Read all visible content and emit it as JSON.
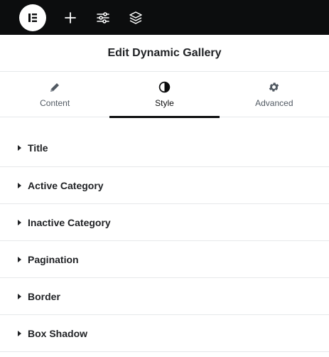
{
  "topbar": {
    "logo_icon": "elementor-logo-icon",
    "buttons": [
      {
        "name": "add-icon"
      },
      {
        "name": "settings-sliders-icon"
      },
      {
        "name": "layers-icon"
      }
    ]
  },
  "header": {
    "title": "Edit Dynamic Gallery"
  },
  "tabs": [
    {
      "label": "Content",
      "icon": "pencil-icon",
      "active": false
    },
    {
      "label": "Style",
      "icon": "contrast-icon",
      "active": true
    },
    {
      "label": "Advanced",
      "icon": "gear-icon",
      "active": false
    }
  ],
  "sections": [
    {
      "label": "Title"
    },
    {
      "label": "Active Category"
    },
    {
      "label": "Inactive Category"
    },
    {
      "label": "Pagination"
    },
    {
      "label": "Border"
    },
    {
      "label": "Box Shadow"
    }
  ],
  "colors": {
    "topbar": "#0c0d0e",
    "text": "#1f2124",
    "divider": "#e6e8ea"
  }
}
